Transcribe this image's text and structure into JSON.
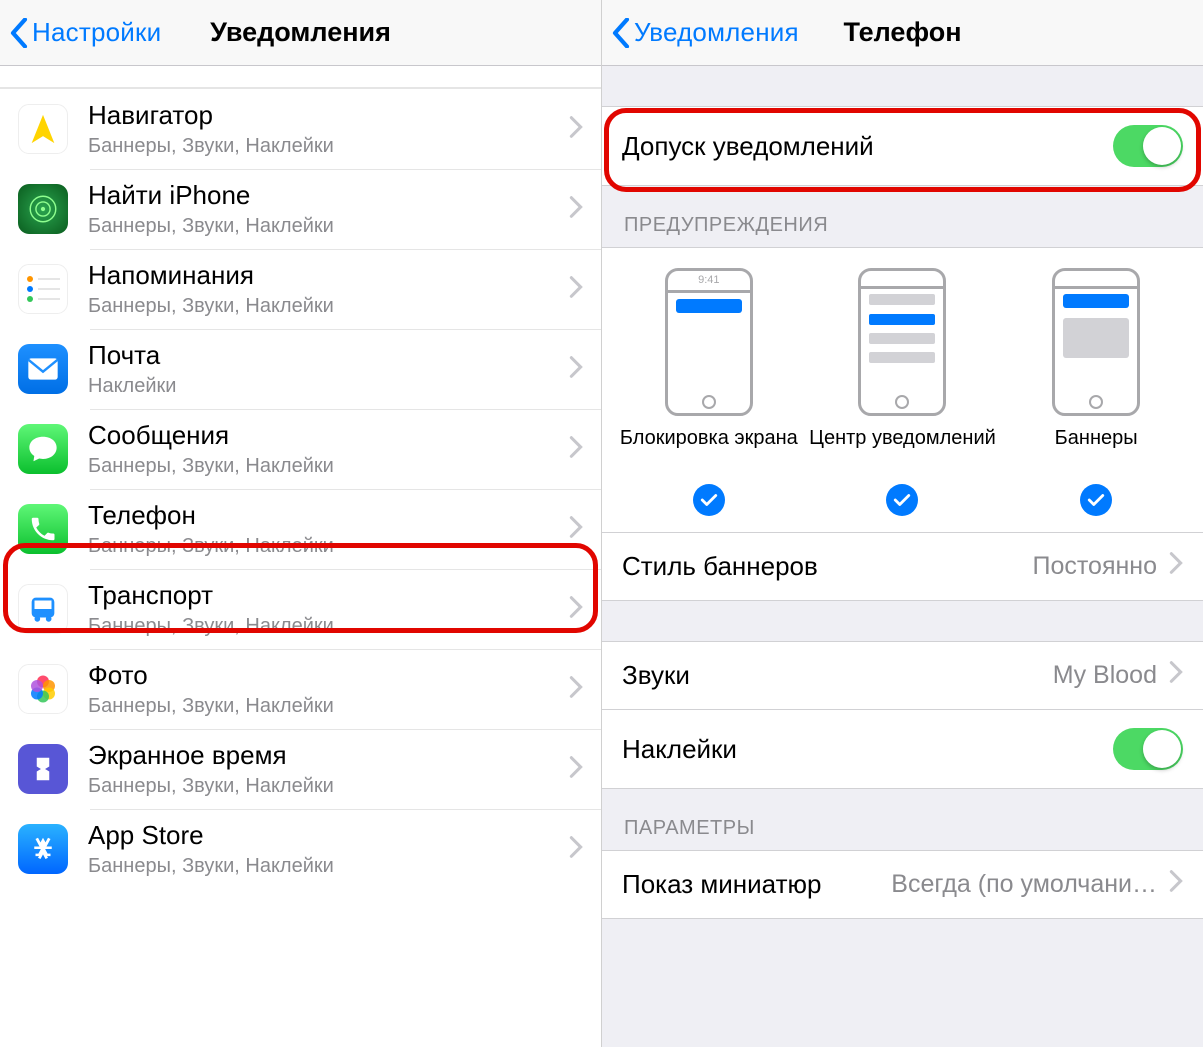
{
  "left": {
    "back_label": "Настройки",
    "title": "Уведомления",
    "apps": [
      {
        "title": "Навигатор",
        "subtitle": "Баннеры, Звуки, Наклейки",
        "icon": "navigator"
      },
      {
        "title": "Найти iPhone",
        "subtitle": "Баннеры, Звуки, Наклейки",
        "icon": "find-iphone"
      },
      {
        "title": "Напоминания",
        "subtitle": "Баннеры, Звуки, Наклейки",
        "icon": "reminders"
      },
      {
        "title": "Почта",
        "subtitle": "Наклейки",
        "icon": "mail"
      },
      {
        "title": "Сообщения",
        "subtitle": "Баннеры, Звуки, Наклейки",
        "icon": "messages"
      },
      {
        "title": "Телефон",
        "subtitle": "Баннеры, Звуки, Наклейки",
        "icon": "phone",
        "highlight": true
      },
      {
        "title": "Транспорт",
        "subtitle": "Баннеры, Звуки, Наклейки",
        "icon": "transit"
      },
      {
        "title": "Фото",
        "subtitle": "Баннеры, Звуки, Наклейки",
        "icon": "photos"
      },
      {
        "title": "Экранное время",
        "subtitle": "Баннеры, Звуки, Наклейки",
        "icon": "screentime"
      },
      {
        "title": "App Store",
        "subtitle": "Баннеры, Звуки, Наклейки",
        "icon": "appstore"
      }
    ]
  },
  "right": {
    "back_label": "Уведомления",
    "title": "Телефон",
    "allow_label": "Допуск уведомлений",
    "allow_on": true,
    "alerts_header": "ПРЕДУПРЕЖДЕНИЯ",
    "alert_styles": [
      {
        "label": "Блокировка экрана",
        "checked": true
      },
      {
        "label": "Центр уведомлений",
        "checked": true
      },
      {
        "label": "Баннеры",
        "checked": true
      }
    ],
    "mock_time": "9:41",
    "banner_style": {
      "label": "Стиль баннеров",
      "value": "Постоянно"
    },
    "sounds": {
      "label": "Звуки",
      "value": "My Blood"
    },
    "badges_label": "Наклейки",
    "badges_on": true,
    "params_header": "ПАРАМЕТРЫ",
    "preview": {
      "label": "Показ миниатюр",
      "value": "Всегда (по умолчани…"
    }
  },
  "colors": {
    "ios_blue": "#007aff",
    "ios_green": "#4cd964",
    "highlight_red": "#e10600"
  }
}
